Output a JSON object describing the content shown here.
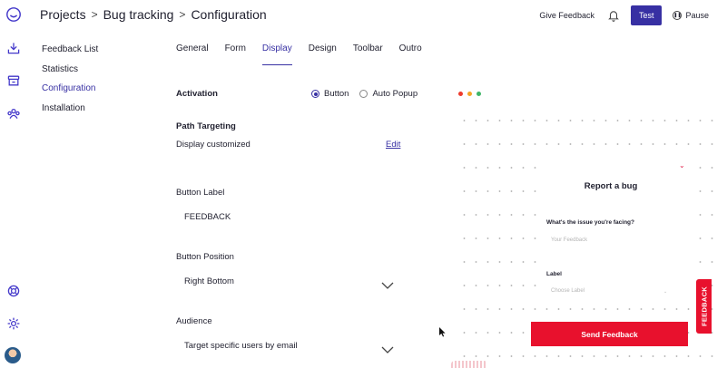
{
  "breadcrumb": {
    "items": [
      "Projects",
      "Bug tracking",
      "Configuration"
    ],
    "separator": ">"
  },
  "header": {
    "give_feedback": "Give Feedback",
    "test_label": "Test",
    "pause_label": "Pause"
  },
  "rail": {
    "icons": [
      "logo-icon",
      "inbox-download-icon",
      "archive-box-icon",
      "team-icon",
      "lifebuoy-icon",
      "settings-icon"
    ]
  },
  "nav": {
    "items": [
      {
        "label": "Feedback List",
        "active": false
      },
      {
        "label": "Statistics",
        "active": false
      },
      {
        "label": "Configuration",
        "active": true
      },
      {
        "label": "Installation",
        "active": false
      }
    ]
  },
  "tabs": [
    {
      "label": "General",
      "active": false
    },
    {
      "label": "Form",
      "active": false
    },
    {
      "label": "Display",
      "active": true
    },
    {
      "label": "Design",
      "active": false
    },
    {
      "label": "Toolbar",
      "active": false
    },
    {
      "label": "Outro",
      "active": false
    }
  ],
  "form": {
    "activation_label": "Activation",
    "activation_options": [
      "Button",
      "Auto Popup"
    ],
    "activation_selected": "Button",
    "path_targeting_label": "Path Targeting",
    "path_targeting_value": "Display customized",
    "edit_label": "Edit",
    "button_label_label": "Button Label",
    "button_label_value": "FEEDBACK",
    "button_position_label": "Button Position",
    "button_position_value": "Right Bottom",
    "audience_label": "Audience",
    "audience_value": "Target specific users by email"
  },
  "preview": {
    "window_dot_colors": [
      "#ee3b2d",
      "#f5a524",
      "#3fb668"
    ],
    "title": "Report a bug",
    "question": "What's the issue you're facing?",
    "question_placeholder": "Your Feedback",
    "label_label": "Label",
    "label_placeholder": "Choose Label",
    "send_button": "Send Feedback",
    "side_tab": "FEEDBACK"
  },
  "colors": {
    "accent": "#3730a3",
    "brand_red": "#e8112d"
  }
}
